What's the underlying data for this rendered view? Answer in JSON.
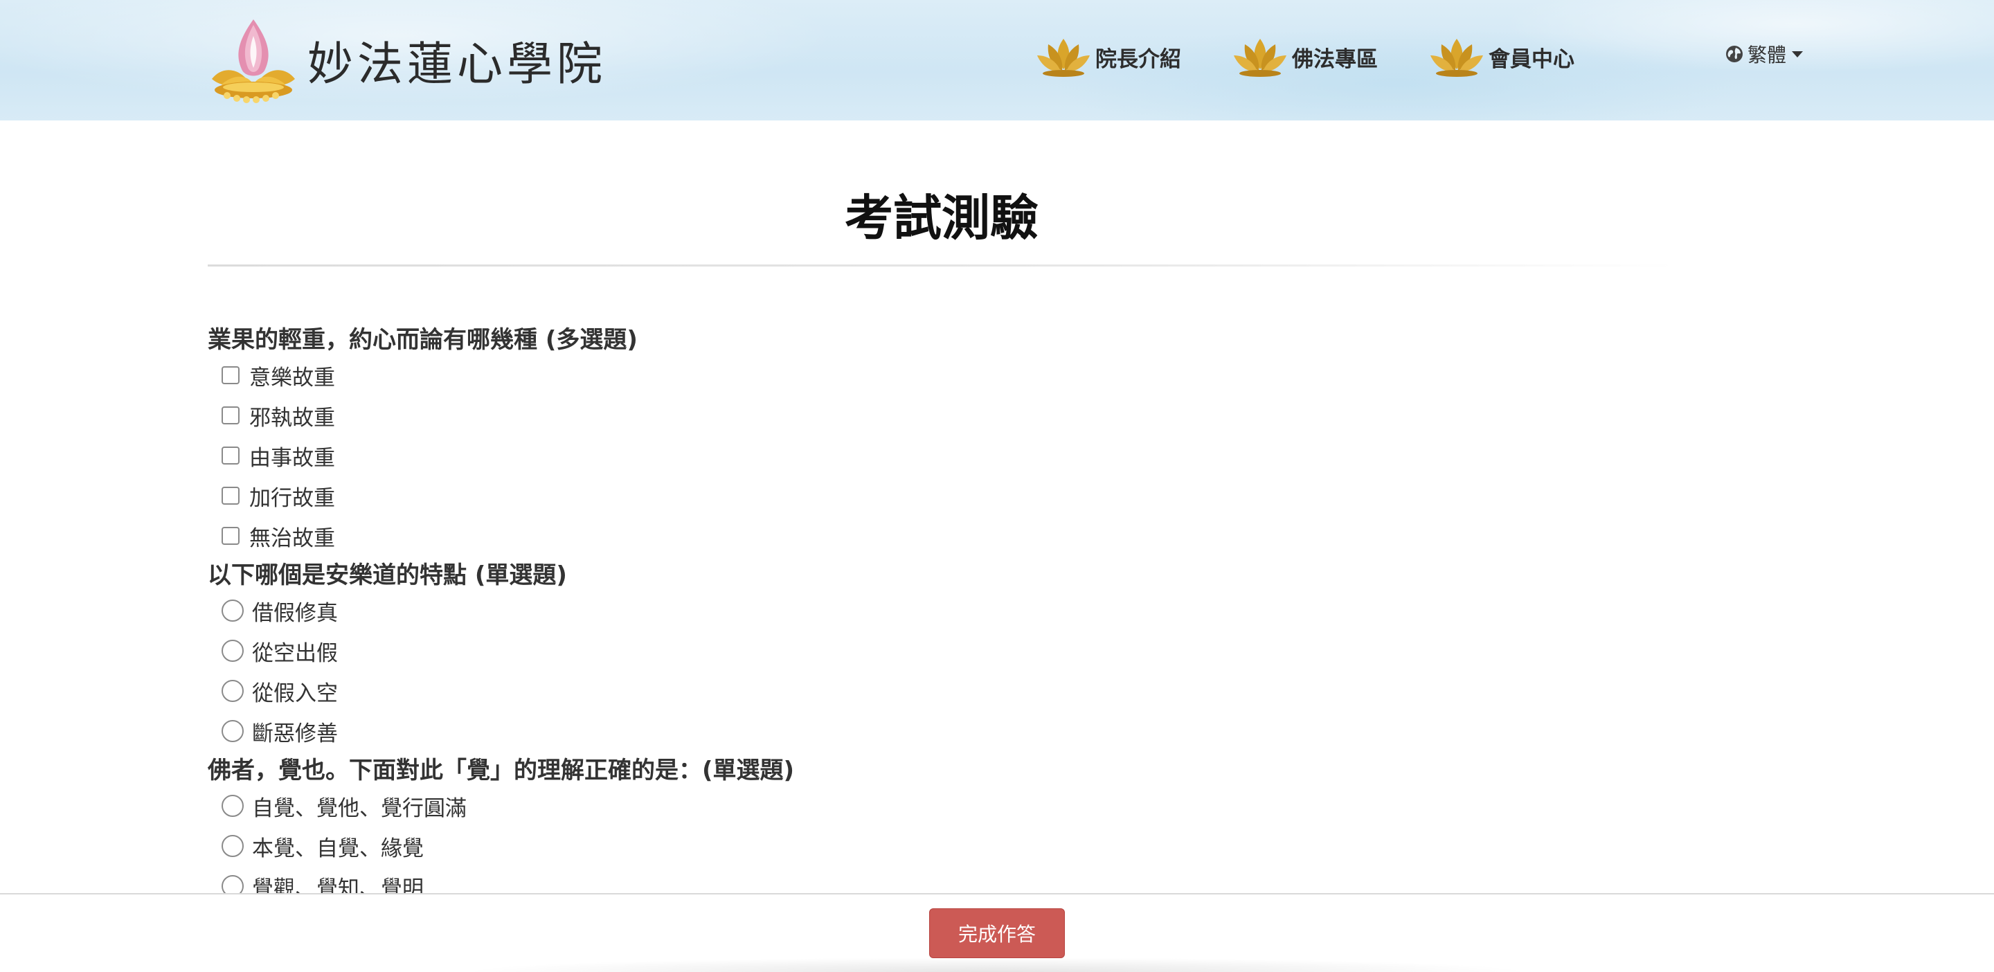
{
  "header": {
    "site_name": "妙法蓮心學院",
    "logo_icon": "lotus-logo-icon",
    "nav": [
      {
        "label": "院長介紹",
        "icon": "lotus-icon"
      },
      {
        "label": "佛法專區",
        "icon": "lotus-icon"
      },
      {
        "label": "會員中心",
        "icon": "lotus-icon"
      }
    ],
    "language": {
      "label": "繁體",
      "icon": "globe-icon"
    }
  },
  "main": {
    "title": "考試測驗",
    "questions": [
      {
        "text": "業果的輕重，約心而論有哪幾種 (多選題)",
        "type": "checkbox",
        "options": [
          "意樂故重",
          "邪執故重",
          "由事故重",
          "加行故重",
          "無治故重"
        ]
      },
      {
        "text": "以下哪個是安樂道的特點 (單選題)",
        "type": "radio",
        "options": [
          "借假修真",
          "從空出假",
          "從假入空",
          "斷惡修善"
        ]
      },
      {
        "text": "佛者，覺也。下面對此「覺」的理解正確的是：(單選題)",
        "type": "radio",
        "options": [
          "自覺、覺他、覺行圓滿",
          "本覺、自覺、緣覺",
          "覺觀、覺知、覺明"
        ]
      }
    ]
  },
  "footer": {
    "submit_label": "完成作答",
    "submit_color": "#cc5a55"
  },
  "colors": {
    "header_bg": "#d6eaf6",
    "lotus_gold": "#d9a52b",
    "lotus_pink": "#e07aa0"
  }
}
